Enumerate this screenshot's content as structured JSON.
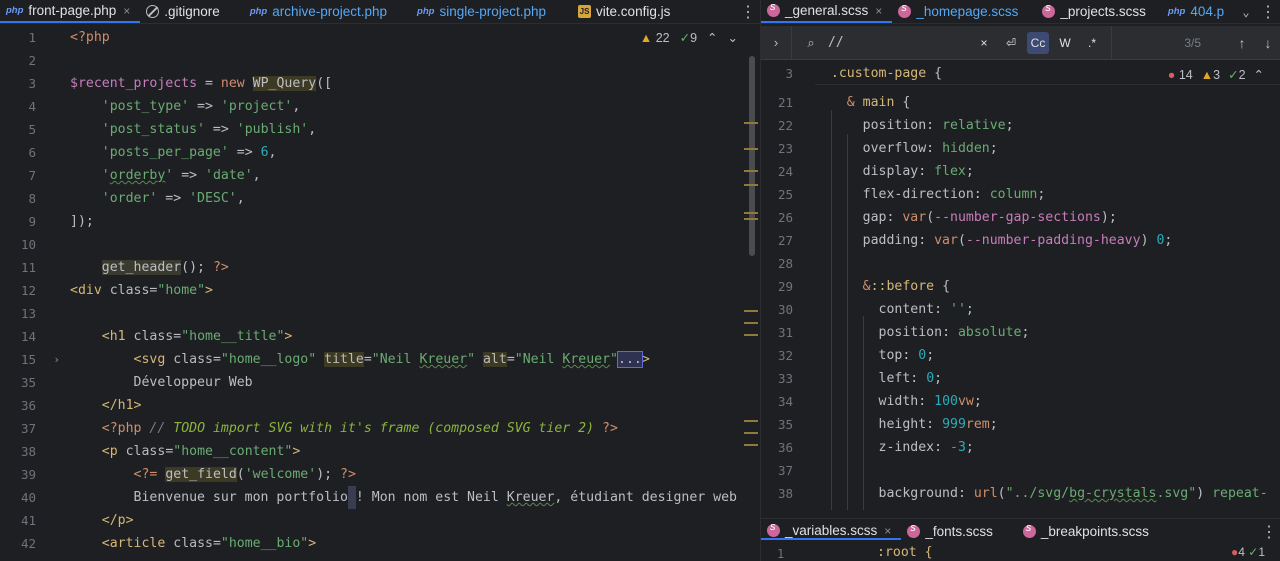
{
  "left": {
    "tabs": [
      {
        "badge": "php",
        "label": "front-page.php",
        "active": true,
        "close": "×"
      },
      {
        "badge": "ignore",
        "label": ".gitignore"
      },
      {
        "badge": "php",
        "label": "archive-project.php",
        "vcs": true
      },
      {
        "badge": "php",
        "label": "single-project.php",
        "vcs": true
      },
      {
        "badge": "js",
        "label": "vite.config.js"
      }
    ],
    "inspections": {
      "warnings": "22",
      "ok": "9"
    },
    "line_numbers": [
      "1",
      "2",
      "3",
      "4",
      "5",
      "6",
      "7",
      "8",
      "9",
      "10",
      "11",
      "12",
      "13",
      "14",
      "15",
      "35",
      "36",
      "37",
      "38",
      "39",
      "40",
      "41",
      "42"
    ]
  },
  "right": {
    "tabs": [
      {
        "label": "_general.scss",
        "active": true,
        "close": "×"
      },
      {
        "label": "_homepage.scss",
        "vcs": true
      },
      {
        "label": "_projects.scss"
      },
      {
        "label": "404.p",
        "badge": "php",
        "vcs": true
      }
    ],
    "find": {
      "query": "//",
      "clear": "×",
      "regex_label": ".*",
      "case_label": "Cc",
      "words_label": "W",
      "count": "3/5"
    },
    "inspections": {
      "errors": "14",
      "warnings": "3",
      "ok": "2"
    },
    "line_numbers": [
      "3",
      "21",
      "22",
      "23",
      "24",
      "25",
      "26",
      "27",
      "28",
      "29",
      "30",
      "31",
      "32",
      "33",
      "34",
      "35",
      "36",
      "37",
      "38"
    ],
    "bottom_tabs": [
      {
        "label": "_variables.scss",
        "active": true,
        "close": "×"
      },
      {
        "label": "_fonts.scss"
      },
      {
        "label": "_breakpoints.scss"
      }
    ],
    "bottom_line_number": "1",
    "bottom_code": ":root {",
    "bottom_inspections": {
      "warnings": "4",
      "ok": "1"
    }
  }
}
